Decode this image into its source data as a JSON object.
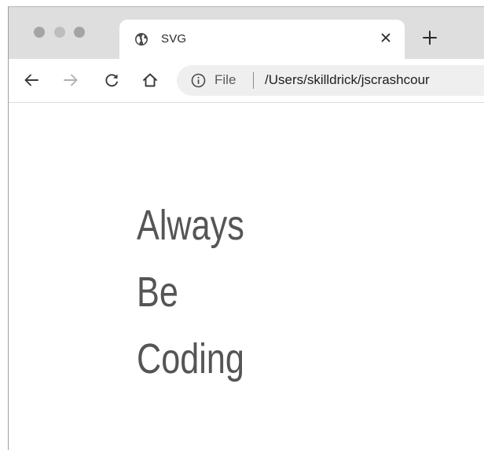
{
  "tab": {
    "title": "SVG",
    "favicon": "globe-icon",
    "close_icon": "close-icon"
  },
  "new_tab_icon": "plus-icon",
  "toolbar": {
    "back_icon": "arrow-left-icon",
    "forward_icon": "arrow-right-icon",
    "reload_icon": "reload-icon",
    "home_icon": "home-icon"
  },
  "omnibox": {
    "info_icon": "info-icon",
    "scheme_label": "File",
    "url": "/Users/skilldrick/jscrashcour"
  },
  "page": {
    "lines": [
      "Always",
      "Be",
      "Coding"
    ]
  },
  "colors": {
    "tabstrip": "#dedede",
    "text": "#555555",
    "omnibox": "#efefef"
  }
}
